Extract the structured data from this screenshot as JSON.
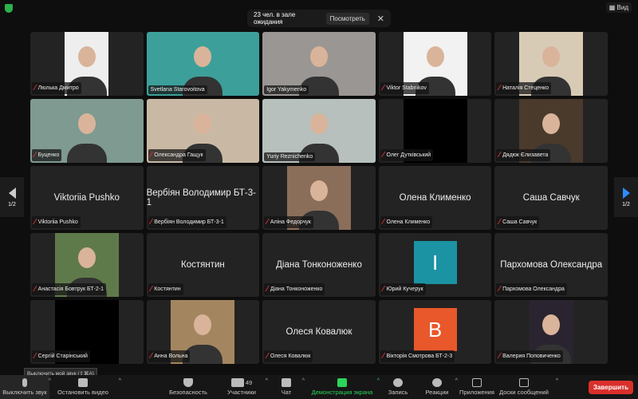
{
  "topbar": {
    "waiting_text": "23 чел. в зале ожидания",
    "view_button": "Посмотреть",
    "close": "✕",
    "layout_button": "Вид"
  },
  "pager": {
    "left": "1/2",
    "right": "1/2"
  },
  "tiles": [
    {
      "name": "Люлька Дмитро",
      "kind": "video",
      "frame": "narrow",
      "bg": "#eeeeee",
      "muted": true
    },
    {
      "name": "Svetlana Starovoitova",
      "kind": "video",
      "frame": "full",
      "bg": "#3d9f9a",
      "muted": false
    },
    {
      "name": "Igor Yakymenko",
      "kind": "video",
      "frame": "full",
      "bg": "#9a9693",
      "muted": false
    },
    {
      "name": "Viktor Stabnikov",
      "kind": "video",
      "frame": "mid",
      "bg": "#f2f2f2",
      "muted": true
    },
    {
      "name": "Наталія Стеценко",
      "kind": "video",
      "frame": "mid",
      "bg": "#d8cbb6",
      "muted": true
    },
    {
      "name": "Буценко",
      "kind": "video",
      "frame": "full",
      "bg": "#7f9a90",
      "muted": true
    },
    {
      "name": "Олександра Гащук",
      "kind": "video",
      "frame": "full",
      "bg": "#c9b9a4",
      "muted": true
    },
    {
      "name": "Yuriy Reznichenko",
      "kind": "video",
      "frame": "full",
      "bg": "#b7c0bd",
      "muted": false,
      "active": true
    },
    {
      "name": "Олег Дутківський",
      "kind": "video",
      "frame": "mid",
      "bg": "#000000",
      "muted": true
    },
    {
      "name": "Дядюк Єлизавета",
      "kind": "video",
      "frame": "mid",
      "bg": "#4a3a2c",
      "muted": true
    },
    {
      "name": "Viktoriia Pushko",
      "kind": "name",
      "muted": true
    },
    {
      "name": "Вербіян Володимир БТ-3-1",
      "kind": "name",
      "muted": true
    },
    {
      "name": "Аліна Федорчук",
      "kind": "video",
      "frame": "mid",
      "bg": "#8a6e5a",
      "muted": true
    },
    {
      "name": "Олена Клименко",
      "kind": "name",
      "muted": true
    },
    {
      "name": "Саша Савчук",
      "kind": "name",
      "muted": true
    },
    {
      "name": "Анастасія Бовтрук БТ-2-1",
      "kind": "video",
      "frame": "mid",
      "bg": "#5f7a4a",
      "muted": true
    },
    {
      "name": "Костянтин",
      "kind": "name",
      "muted": true
    },
    {
      "name": "Діана Тонконоженко",
      "kind": "name",
      "muted": true
    },
    {
      "name": "Юрий Кучерук",
      "kind": "avatar",
      "letter": "I",
      "bg": "#1b93a3",
      "muted": true
    },
    {
      "name": "Пархомова Олександра",
      "kind": "name",
      "muted": true
    },
    {
      "name": "Сергій Старінський",
      "kind": "video",
      "frame": "mid",
      "bg": "#000000",
      "muted": true
    },
    {
      "name": "Анна Вольна",
      "kind": "video",
      "frame": "mid",
      "bg": "#a38660",
      "muted": true
    },
    {
      "name": "Олеся Ковалюк",
      "kind": "name",
      "muted": true
    },
    {
      "name": "Вікторія Смотрова БТ-2-3",
      "kind": "avatar",
      "letter": "B",
      "bg": "#e8582a",
      "muted": true
    },
    {
      "name": "Валерия Поповиченко",
      "kind": "video",
      "frame": "narrow",
      "bg": "#2a2430",
      "muted": true
    }
  ],
  "tooltip": "Выключить мой звук (⇧⌘A)",
  "toolbar": {
    "mute": "Выключить звук",
    "video": "Остановить видео",
    "security": "Безопасность",
    "participants": "Участники",
    "participants_count": "49",
    "chat": "Чат",
    "share": "Демонстрация экрана",
    "record": "Запись",
    "reactions": "Реакции",
    "apps": "Приложения",
    "whiteboards": "Доски сообщений",
    "end": "Завершить"
  },
  "colors": {
    "share": "#2bd45a",
    "end": "#d9302c",
    "active_speaker": "#3ac24f",
    "pager_accent": "#2d8cff"
  }
}
